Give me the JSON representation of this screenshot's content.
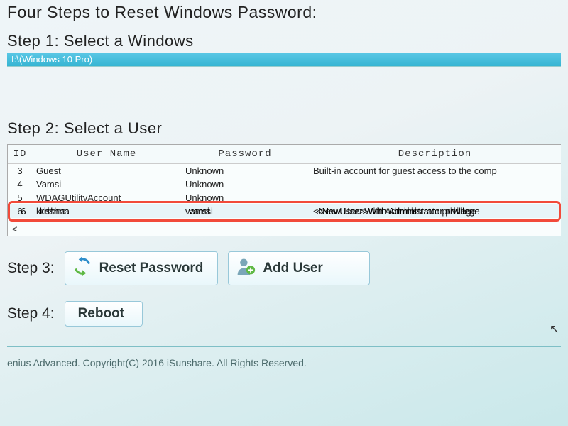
{
  "page_title": "Four Steps to Reset Windows Password:",
  "step1": {
    "label": "Step 1: Select a Windows",
    "selected": "I:\\(Windows 10 Pro)"
  },
  "step2": {
    "label": "Step 2: Select a User",
    "columns": {
      "id": "ID",
      "user": "User Name",
      "password": "Password",
      "description": "Description"
    },
    "rows": [
      {
        "id": "3",
        "user": "Guest",
        "password": "Unknown",
        "description": "Built-in account for guest access to the comp"
      },
      {
        "id": "4",
        "user": "Vamsi",
        "password": "Unknown",
        "description": ""
      },
      {
        "id": "5",
        "user": "WDAGUtilityAccount",
        "password": "Unknown",
        "description": ""
      },
      {
        "id": "6",
        "user": "krishna",
        "password": "vamsi",
        "description": "<New User>With Administrator privilege"
      }
    ],
    "scroll_indicator": "<"
  },
  "step3": {
    "label": "Step 3:",
    "reset_button": "Reset Password",
    "adduser_button": "Add User"
  },
  "step4": {
    "label": "Step 4:",
    "reboot_button": "Reboot"
  },
  "footer": "enius Advanced. Copyright(C) 2016 iSunshare. All Rights Reserved."
}
